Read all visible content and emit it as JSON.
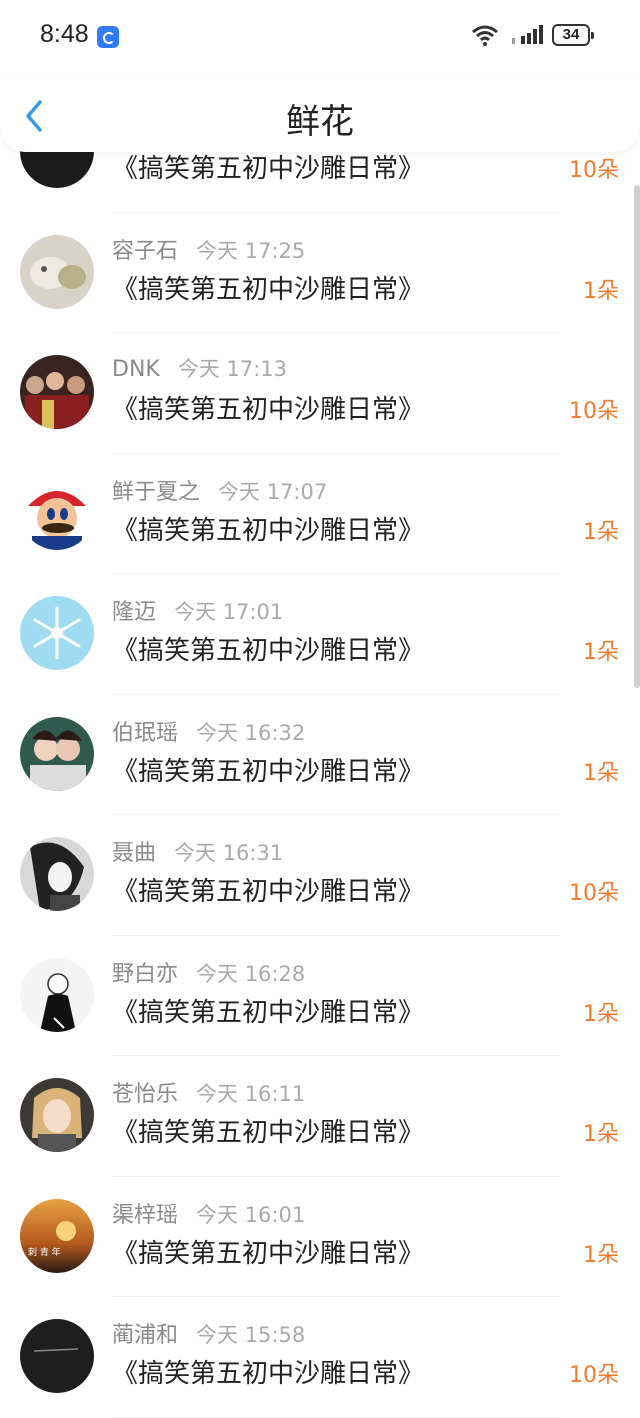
{
  "status_bar": {
    "time": "8:48",
    "battery": "34"
  },
  "nav": {
    "title": "鲜花"
  },
  "list": [
    {
      "name": "",
      "time": "",
      "title": "《搞笑第五初中沙雕日常》",
      "amount": "10朵",
      "avatar": "dark"
    },
    {
      "name": "容子石",
      "time": "今天 17:25",
      "title": "《搞笑第五初中沙雕日常》",
      "amount": "1朵",
      "avatar": "cat"
    },
    {
      "name": "DNK",
      "time": "今天 17:13",
      "title": "《搞笑第五初中沙雕日常》",
      "amount": "10朵",
      "avatar": "group"
    },
    {
      "name": "鲜于夏之",
      "time": "今天 17:07",
      "title": "《搞笑第五初中沙雕日常》",
      "amount": "1朵",
      "avatar": "mario"
    },
    {
      "name": "隆迈",
      "time": "今天 17:01",
      "title": "《搞笑第五初中沙雕日常》",
      "amount": "1朵",
      "avatar": "snowflake"
    },
    {
      "name": "伯珉瑶",
      "time": "今天 16:32",
      "title": "《搞笑第五初中沙雕日常》",
      "amount": "1朵",
      "avatar": "couple"
    },
    {
      "name": "聂曲",
      "time": "今天 16:31",
      "title": "《搞笑第五初中沙雕日常》",
      "amount": "10朵",
      "avatar": "bw-portrait"
    },
    {
      "name": "野白亦",
      "time": "今天 16:28",
      "title": "《搞笑第五初中沙雕日常》",
      "amount": "1朵",
      "avatar": "sketch"
    },
    {
      "name": "苍怡乐",
      "time": "今天 16:11",
      "title": "《搞笑第五初中沙雕日常》",
      "amount": "1朵",
      "avatar": "selfie"
    },
    {
      "name": "渠梓瑶",
      "time": "今天 16:01",
      "title": "《搞笑第五初中沙雕日常》",
      "amount": "1朵",
      "avatar": "sunset"
    },
    {
      "name": "蔺浦和",
      "time": "今天 15:58",
      "title": "《搞笑第五初中沙雕日常》",
      "amount": "10朵",
      "avatar": "black"
    }
  ],
  "colors": {
    "accent": "#f07c2e",
    "back": "#2f9bf0"
  }
}
